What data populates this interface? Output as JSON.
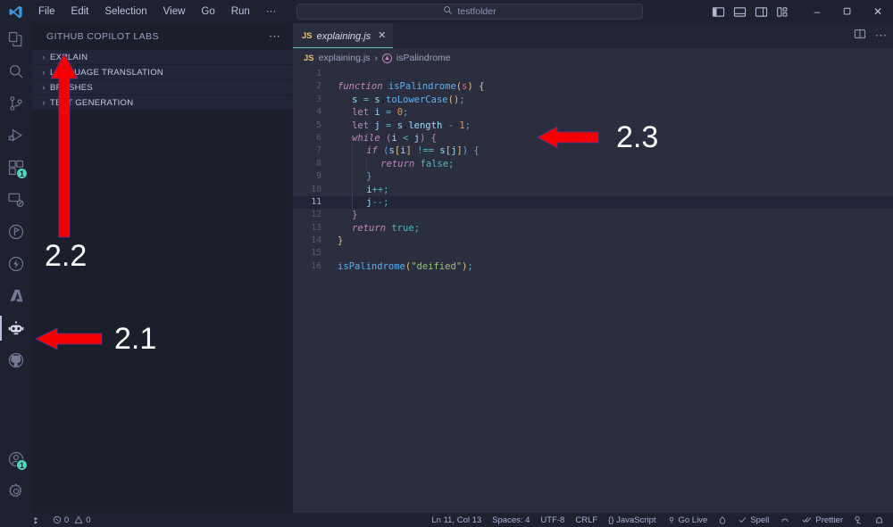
{
  "titlebar": {
    "logo_icon": "vscode-logo-icon",
    "menu": [
      "File",
      "Edit",
      "Selection",
      "View",
      "Go",
      "Run",
      "···"
    ],
    "back_icon": "arrow-left-icon",
    "forward_icon": "arrow-right-icon",
    "search": {
      "icon": "search-icon",
      "value": "testfolder"
    },
    "layout_icons": [
      "toggle-primary-sidebar-icon",
      "toggle-panel-icon",
      "toggle-secondary-sidebar-icon",
      "customize-layout-icon"
    ],
    "window_controls": {
      "minimize": "–",
      "maximize": "❐",
      "close": "✕"
    }
  },
  "activitybar": {
    "items": [
      {
        "name": "explorer",
        "icon": "files-icon",
        "active": false,
        "badge": ""
      },
      {
        "name": "search",
        "icon": "search-icon",
        "active": false,
        "badge": ""
      },
      {
        "name": "source-control",
        "icon": "source-control-icon",
        "active": false,
        "badge": ""
      },
      {
        "name": "run-and-debug",
        "icon": "run-debug-icon",
        "active": false,
        "badge": ""
      },
      {
        "name": "extensions",
        "icon": "extensions-icon",
        "active": false,
        "badge": "1"
      },
      {
        "name": "remote-explorer",
        "icon": "remote-explorer-icon",
        "active": false,
        "badge": ""
      },
      {
        "name": "testing",
        "icon": "beaker-icon",
        "active": false,
        "badge": ""
      },
      {
        "name": "thunder-client",
        "icon": "lightning-icon",
        "active": false,
        "badge": ""
      },
      {
        "name": "azure",
        "icon": "azure-icon",
        "active": false,
        "badge": ""
      },
      {
        "name": "copilot-labs",
        "icon": "copilot-robot-icon",
        "active": true,
        "badge": ""
      },
      {
        "name": "github",
        "icon": "github-icon",
        "active": false,
        "badge": ""
      }
    ],
    "bottom_items": [
      {
        "name": "accounts",
        "icon": "account-icon",
        "badge": "1"
      },
      {
        "name": "manage-settings",
        "icon": "gear-icon",
        "badge": ""
      }
    ]
  },
  "sidebar": {
    "title": "GITHUB COPILOT LABS",
    "more_actions_icon": "ellipsis-icon",
    "sections": [
      {
        "label": "EXPLAIN",
        "chevron": "›",
        "expanded": false
      },
      {
        "label": "LANGUAGE TRANSLATION",
        "chevron": "›",
        "expanded": false
      },
      {
        "label": "BRUSHES",
        "chevron": "›",
        "expanded": false
      },
      {
        "label": "TEST GENERATION",
        "chevron": "›",
        "expanded": false
      }
    ]
  },
  "editor": {
    "tab": {
      "file_icon": "JS",
      "label": "explaining.js",
      "close_icon": "✕"
    },
    "tab_actions": [
      "split-editor-right-icon",
      "more-actions-icon"
    ],
    "breadcrumb": {
      "file_icon": "JS",
      "file": "explaining.js",
      "separator": "›",
      "symbol_icon": "function-symbol-icon",
      "symbol": "isPalindrome"
    },
    "lines": [
      {
        "n": "1",
        "indent": 0,
        "tokens": []
      },
      {
        "n": "2",
        "indent": 0,
        "tokens": [
          {
            "t": "function ",
            "c": "kwi"
          },
          {
            "t": "isPalindrome",
            "c": "fn"
          },
          {
            "t": "(",
            "c": "pun1"
          },
          {
            "t": "s",
            "c": "par"
          },
          {
            "t": ")",
            "c": "pun1"
          },
          {
            "t": " ",
            "c": ""
          },
          {
            "t": "{",
            "c": "pun1"
          }
        ]
      },
      {
        "n": "3",
        "indent": 1,
        "tokens": [
          {
            "t": "s",
            "c": "var"
          },
          {
            "t": " = ",
            "c": "op"
          },
          {
            "t": "s",
            "c": "var"
          },
          {
            "t": ".",
            "c": ""
          },
          {
            "t": "toLowerCase",
            "c": "fn"
          },
          {
            "t": "()",
            "c": "pun1"
          },
          {
            "t": ";",
            "c": "op"
          }
        ]
      },
      {
        "n": "4",
        "indent": 1,
        "tokens": [
          {
            "t": "let ",
            "c": "kw"
          },
          {
            "t": "i",
            "c": "var"
          },
          {
            "t": " = ",
            "c": "op"
          },
          {
            "t": "0",
            "c": "num"
          },
          {
            "t": ";",
            "c": "op"
          }
        ]
      },
      {
        "n": "5",
        "indent": 1,
        "tokens": [
          {
            "t": "let ",
            "c": "kw"
          },
          {
            "t": "j",
            "c": "var"
          },
          {
            "t": " = ",
            "c": "op"
          },
          {
            "t": "s",
            "c": "var"
          },
          {
            "t": ".",
            "c": ""
          },
          {
            "t": "length",
            "c": "var"
          },
          {
            "t": " - ",
            "c": "op"
          },
          {
            "t": "1",
            "c": "num"
          },
          {
            "t": ";",
            "c": "op"
          }
        ]
      },
      {
        "n": "6",
        "indent": 1,
        "tokens": [
          {
            "t": "while ",
            "c": "ctl"
          },
          {
            "t": "(",
            "c": "pun2"
          },
          {
            "t": "i",
            "c": "var"
          },
          {
            "t": " < ",
            "c": "op"
          },
          {
            "t": "j",
            "c": "var"
          },
          {
            "t": ") ",
            "c": "pun2"
          },
          {
            "t": "{",
            "c": "pun2"
          }
        ]
      },
      {
        "n": "7",
        "indent": 2,
        "tokens": [
          {
            "t": "if ",
            "c": "ctl"
          },
          {
            "t": "(",
            "c": "pun3"
          },
          {
            "t": "s",
            "c": "var"
          },
          {
            "t": "[",
            "c": "pun1"
          },
          {
            "t": "i",
            "c": "var"
          },
          {
            "t": "]",
            "c": "pun1"
          },
          {
            "t": " !== ",
            "c": "op"
          },
          {
            "t": "s",
            "c": "var"
          },
          {
            "t": "[",
            "c": "pun1"
          },
          {
            "t": "j",
            "c": "var"
          },
          {
            "t": "]",
            "c": "pun1"
          },
          {
            "t": ")",
            "c": "pun3"
          },
          {
            "t": " ",
            "c": ""
          },
          {
            "t": "{",
            "c": "pun3"
          }
        ]
      },
      {
        "n": "8",
        "indent": 3,
        "tokens": [
          {
            "t": "return ",
            "c": "ctl"
          },
          {
            "t": "false",
            "c": "lit"
          },
          {
            "t": ";",
            "c": "op"
          }
        ]
      },
      {
        "n": "9",
        "indent": 2,
        "tokens": [
          {
            "t": "}",
            "c": "pun3"
          }
        ]
      },
      {
        "n": "10",
        "indent": 2,
        "tokens": [
          {
            "t": "i",
            "c": "var"
          },
          {
            "t": "++",
            "c": "op"
          },
          {
            "t": ";",
            "c": "op"
          }
        ]
      },
      {
        "n": "11",
        "indent": 2,
        "active": true,
        "tokens": [
          {
            "t": "j",
            "c": "var"
          },
          {
            "t": "--",
            "c": "op"
          },
          {
            "t": ";",
            "c": "op"
          }
        ]
      },
      {
        "n": "12",
        "indent": 1,
        "tokens": [
          {
            "t": "}",
            "c": "pun2"
          }
        ]
      },
      {
        "n": "13",
        "indent": 1,
        "tokens": [
          {
            "t": "return ",
            "c": "ctl"
          },
          {
            "t": "true",
            "c": "lit"
          },
          {
            "t": ";",
            "c": "op"
          }
        ]
      },
      {
        "n": "14",
        "indent": 0,
        "tokens": [
          {
            "t": "}",
            "c": "pun1"
          }
        ]
      },
      {
        "n": "15",
        "indent": 0,
        "tokens": []
      },
      {
        "n": "16",
        "indent": 0,
        "tokens": [
          {
            "t": "isPalindrome",
            "c": "fn"
          },
          {
            "t": "(",
            "c": "pun1"
          },
          {
            "t": "\"deified\"",
            "c": "str"
          },
          {
            "t": ")",
            "c": "pun1"
          },
          {
            "t": ";",
            "c": "op"
          }
        ]
      }
    ]
  },
  "statusbar": {
    "left": [
      {
        "name": "remote-host",
        "icon": "remote-icon",
        "label": ""
      },
      {
        "name": "problems",
        "icon": "error-icon",
        "label": "0",
        "icon2": "warning-icon",
        "label2": "0"
      }
    ],
    "right": [
      {
        "name": "cursor-position",
        "label": "Ln 11, Col 13"
      },
      {
        "name": "indentation",
        "label": "Spaces: 4"
      },
      {
        "name": "encoding",
        "label": "UTF-8"
      },
      {
        "name": "line-endings",
        "label": "CRLF"
      },
      {
        "name": "language-mode",
        "label": "{} JavaScript"
      },
      {
        "name": "go-live",
        "label": "Go Live"
      },
      {
        "name": "gitlens",
        "label": ""
      },
      {
        "name": "spell-checker",
        "label": "Spell"
      },
      {
        "name": "bracket-pair",
        "label": ""
      },
      {
        "name": "prettier",
        "label": "Prettier"
      },
      {
        "name": "remote-tunnel",
        "label": ""
      },
      {
        "name": "notifications",
        "label": ""
      }
    ]
  },
  "annotations": [
    {
      "name": "annotation-2-1",
      "label": "2.1"
    },
    {
      "name": "annotation-2-2",
      "label": "2.2"
    },
    {
      "name": "annotation-2-3",
      "label": "2.3"
    }
  ],
  "colors": {
    "titlebar_bg": "#1e2130",
    "sidebar_bg": "#1b1e2b",
    "editor_bg": "#2b2e3e",
    "accent": "#6ec3bd",
    "annotation_red": "#f40000",
    "badge_green": "#4fd6be"
  }
}
